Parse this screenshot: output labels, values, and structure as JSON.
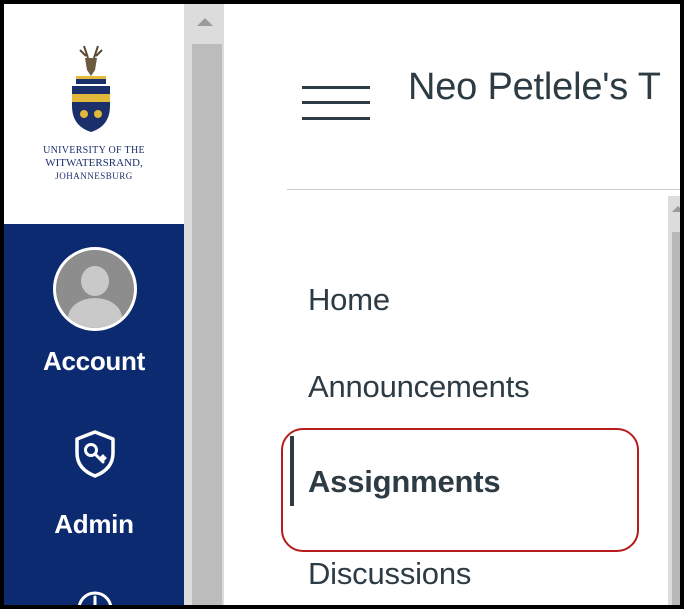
{
  "global_nav": {
    "logo": {
      "line1": "UNIVERSITY OF THE",
      "line2": "WITWATERSRAND,",
      "line3": "JOHANNESBURG"
    },
    "items": [
      {
        "label": "Account",
        "icon": "user-avatar-icon"
      },
      {
        "label": "Admin",
        "icon": "shield-key-icon"
      }
    ],
    "colors": {
      "nav_bg": "#0b2a6f",
      "text": "#ffffff"
    }
  },
  "header": {
    "course_title": "Neo Petlele's T"
  },
  "course_nav": {
    "items": [
      {
        "label": "Home"
      },
      {
        "label": "Announcements"
      },
      {
        "label": "Assignments",
        "active": true
      },
      {
        "label": "Discussions"
      }
    ],
    "highlight_color": "#b71c1c"
  }
}
